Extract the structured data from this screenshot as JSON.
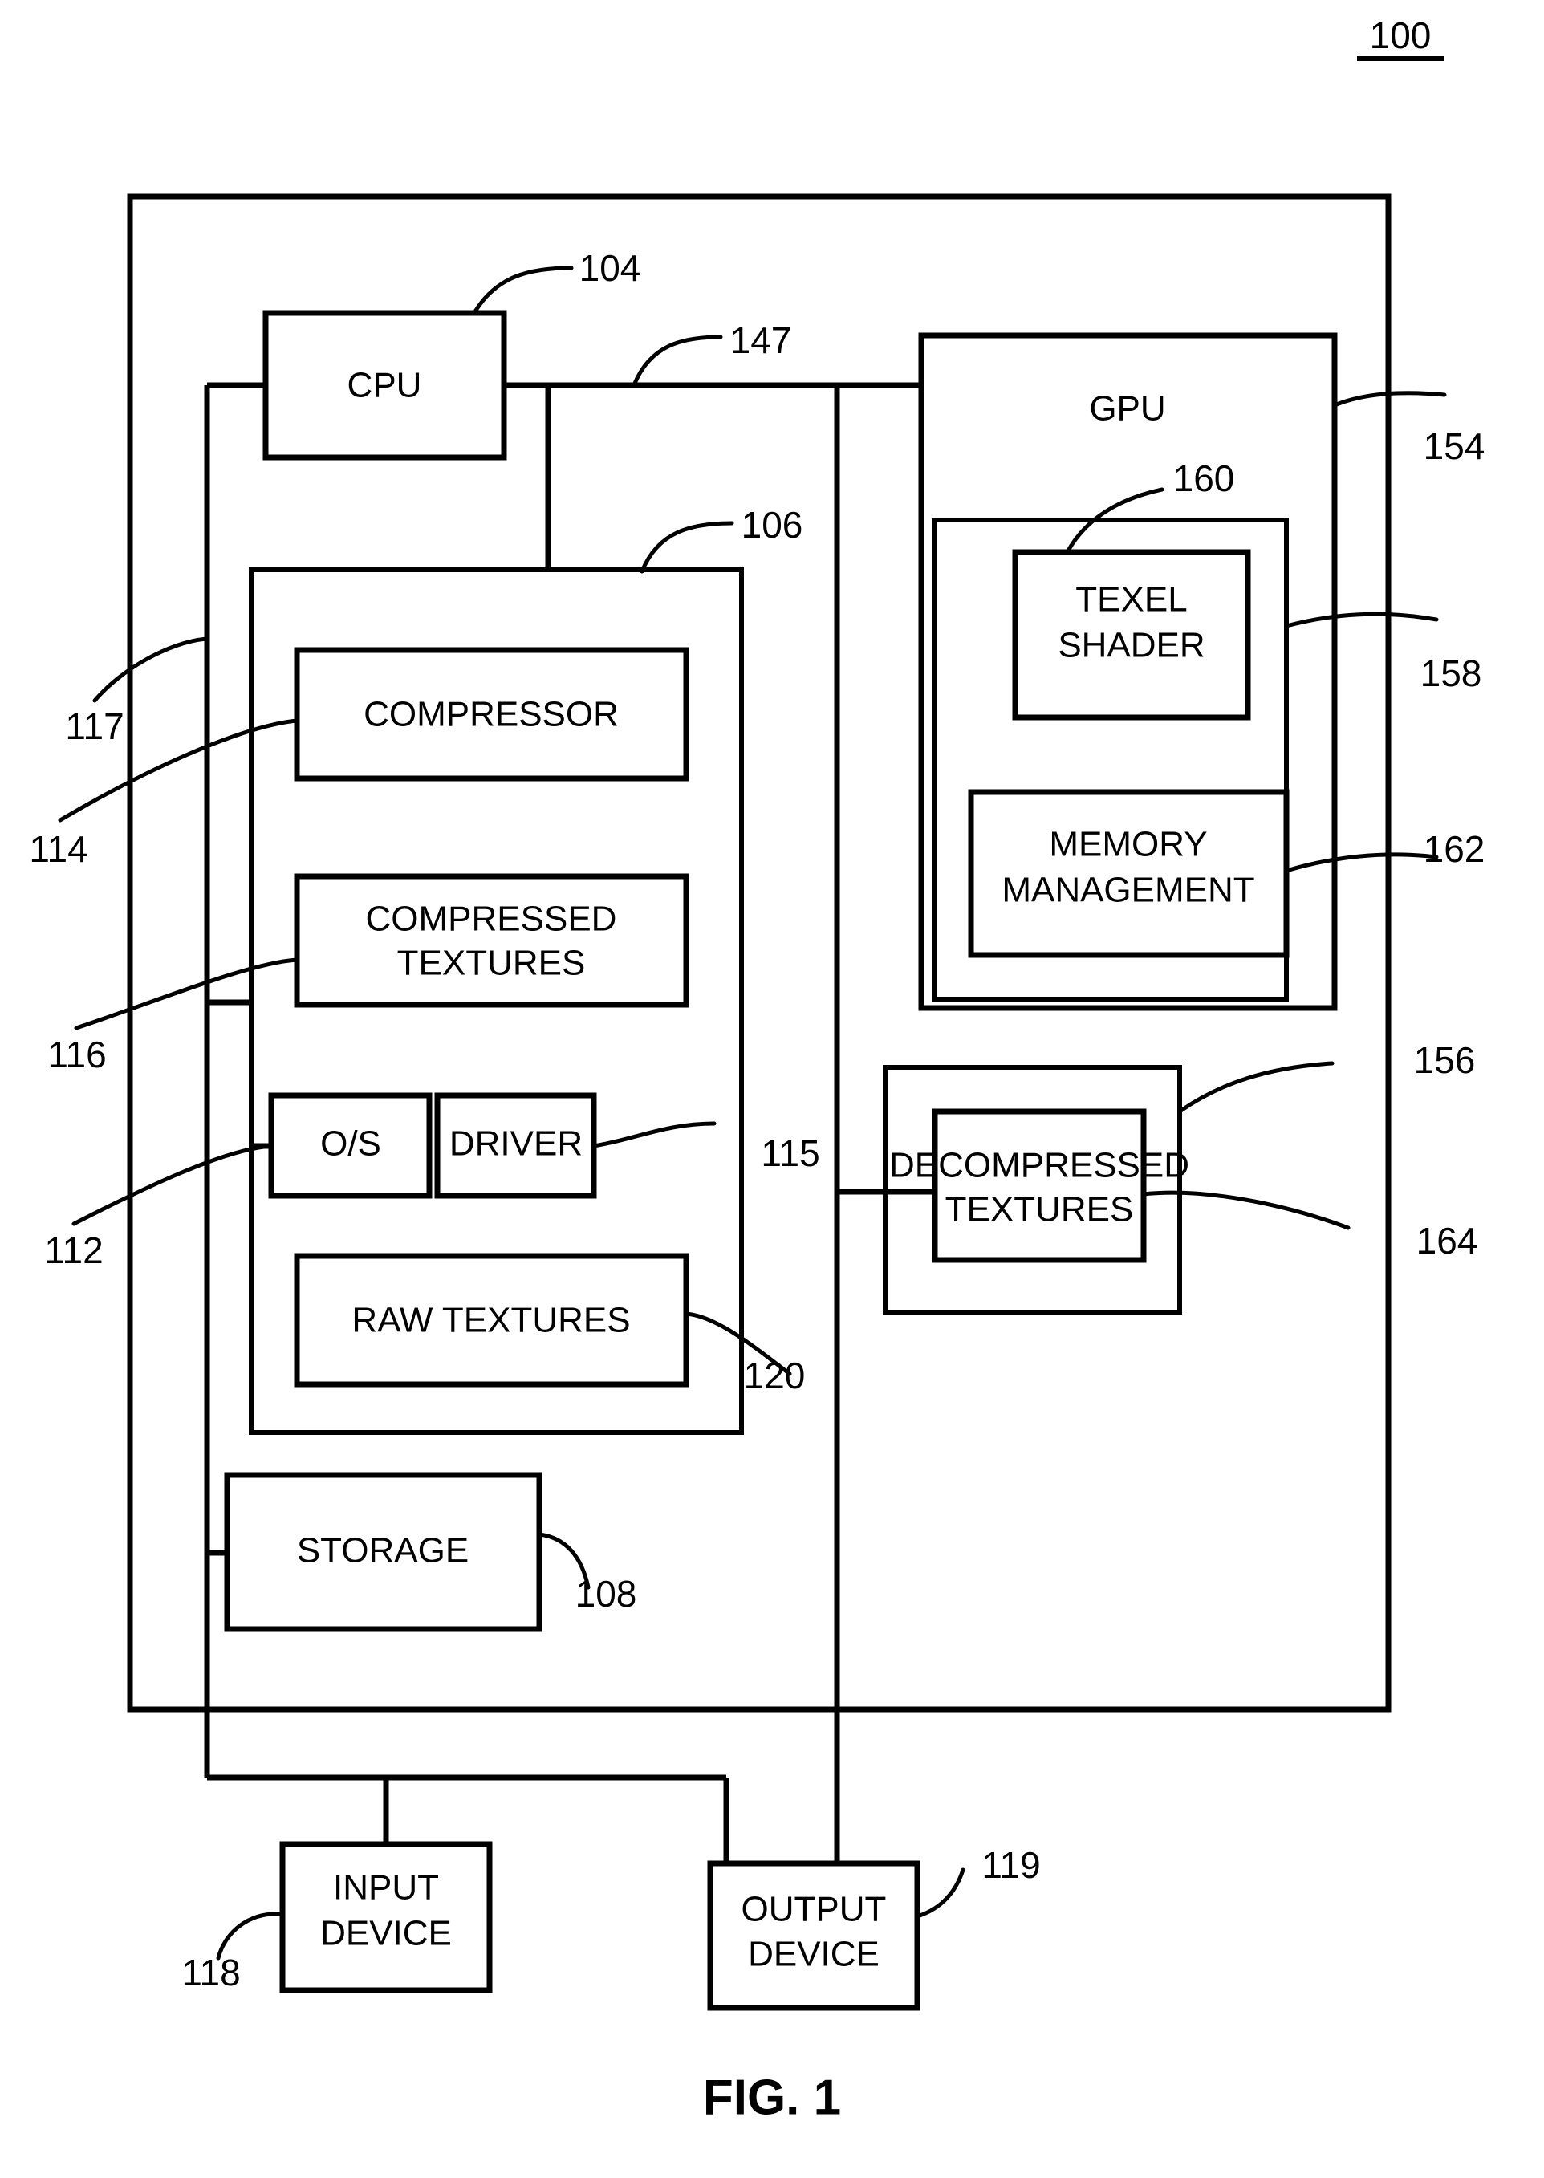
{
  "figure": {
    "caption": "FIG. 1",
    "system_ref": "100",
    "accent_color": "#000000",
    "background_color": "#ffffff"
  },
  "blocks": [
    {
      "id": "cpu",
      "label": "CPU",
      "ref": "104"
    },
    {
      "id": "memory",
      "label": "",
      "ref": "106"
    },
    {
      "id": "compressor",
      "label": "COMPRESSOR",
      "ref": "114"
    },
    {
      "id": "compressed-textures",
      "label_line1": "COMPRESSED",
      "label_line2": "TEXTURES",
      "ref": "116"
    },
    {
      "id": "os",
      "label": "O/S",
      "ref": "112"
    },
    {
      "id": "driver",
      "label": "DRIVER",
      "ref": "115"
    },
    {
      "id": "raw-textures",
      "label": "RAW TEXTURES",
      "ref": "120"
    },
    {
      "id": "storage",
      "label": "STORAGE",
      "ref": "108"
    },
    {
      "id": "gpu",
      "label": "GPU",
      "ref": "154"
    },
    {
      "id": "gpu-core",
      "label": "",
      "ref": "158"
    },
    {
      "id": "texel-shader",
      "label_line1": "TEXEL",
      "label_line2": "SHADER",
      "ref": "160"
    },
    {
      "id": "memory-management",
      "label_line1": "MEMORY",
      "label_line2": "MANAGEMENT",
      "ref": "162"
    },
    {
      "id": "gpu-memory",
      "label": "",
      "ref": "156"
    },
    {
      "id": "decompressed-textures",
      "label_line1": "DECOMPRESSED",
      "label_line2": "TEXTURES",
      "ref": "164"
    },
    {
      "id": "input-device",
      "label_line1": "INPUT",
      "label_line2": "DEVICE",
      "ref": "118"
    },
    {
      "id": "output-device",
      "label_line1": "OUTPUT",
      "label_line2": "DEVICE",
      "ref": "119"
    }
  ],
  "bus_refs": [
    {
      "id": "system-bus",
      "ref": "147"
    },
    {
      "id": "internal-bus",
      "ref": "117"
    }
  ],
  "labels": {
    "cpu": "CPU",
    "gpu": "GPU",
    "compressor": "COMPRESSOR",
    "compressed_textures_l1": "COMPRESSED",
    "compressed_textures_l2": "TEXTURES",
    "os": "O/S",
    "driver": "DRIVER",
    "raw_textures": "RAW TEXTURES",
    "storage": "STORAGE",
    "texel_shader_l1": "TEXEL",
    "texel_shader_l2": "SHADER",
    "memory_management_l1": "MEMORY",
    "memory_management_l2": "MANAGEMENT",
    "decompressed_textures_l1": "DECOMPRESSED",
    "decompressed_textures_l2": "TEXTURES",
    "input_device_l1": "INPUT",
    "input_device_l2": "DEVICE",
    "output_device_l1": "OUTPUT",
    "output_device_l2": "DEVICE"
  },
  "refs": {
    "system": "100",
    "cpu": "104",
    "memory": "106",
    "storage": "108",
    "os": "112",
    "compressor": "114",
    "driver": "115",
    "compressed_textures": "116",
    "internal_bus": "117",
    "input_device": "118",
    "output_device": "119",
    "raw_textures": "120",
    "system_bus": "147",
    "gpu": "154",
    "gpu_memory": "156",
    "gpu_core": "158",
    "texel_shader": "160",
    "memory_management": "162",
    "decompressed_textures": "164"
  },
  "caption": "FIG. 1"
}
